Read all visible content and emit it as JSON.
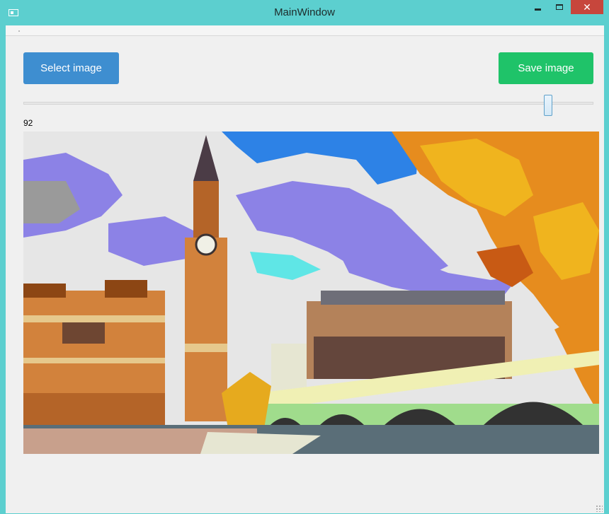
{
  "window": {
    "title": "MainWindow",
    "close_glyph": "✕"
  },
  "toolbar": {
    "select_label": "Select image",
    "save_label": "Save image"
  },
  "slider": {
    "value": 92,
    "value_text": "92",
    "min": 0,
    "max": 100
  },
  "colors": {
    "titlebar": "#5ccfcf",
    "select_button": "#3e8ed0",
    "save_button": "#1fc369",
    "close_button": "#c7463c"
  },
  "icons": {
    "app": "app-window-icon",
    "minimize": "minimize-icon",
    "maximize": "maximize-icon",
    "close": "close-icon",
    "resize": "resize-grip-icon"
  }
}
